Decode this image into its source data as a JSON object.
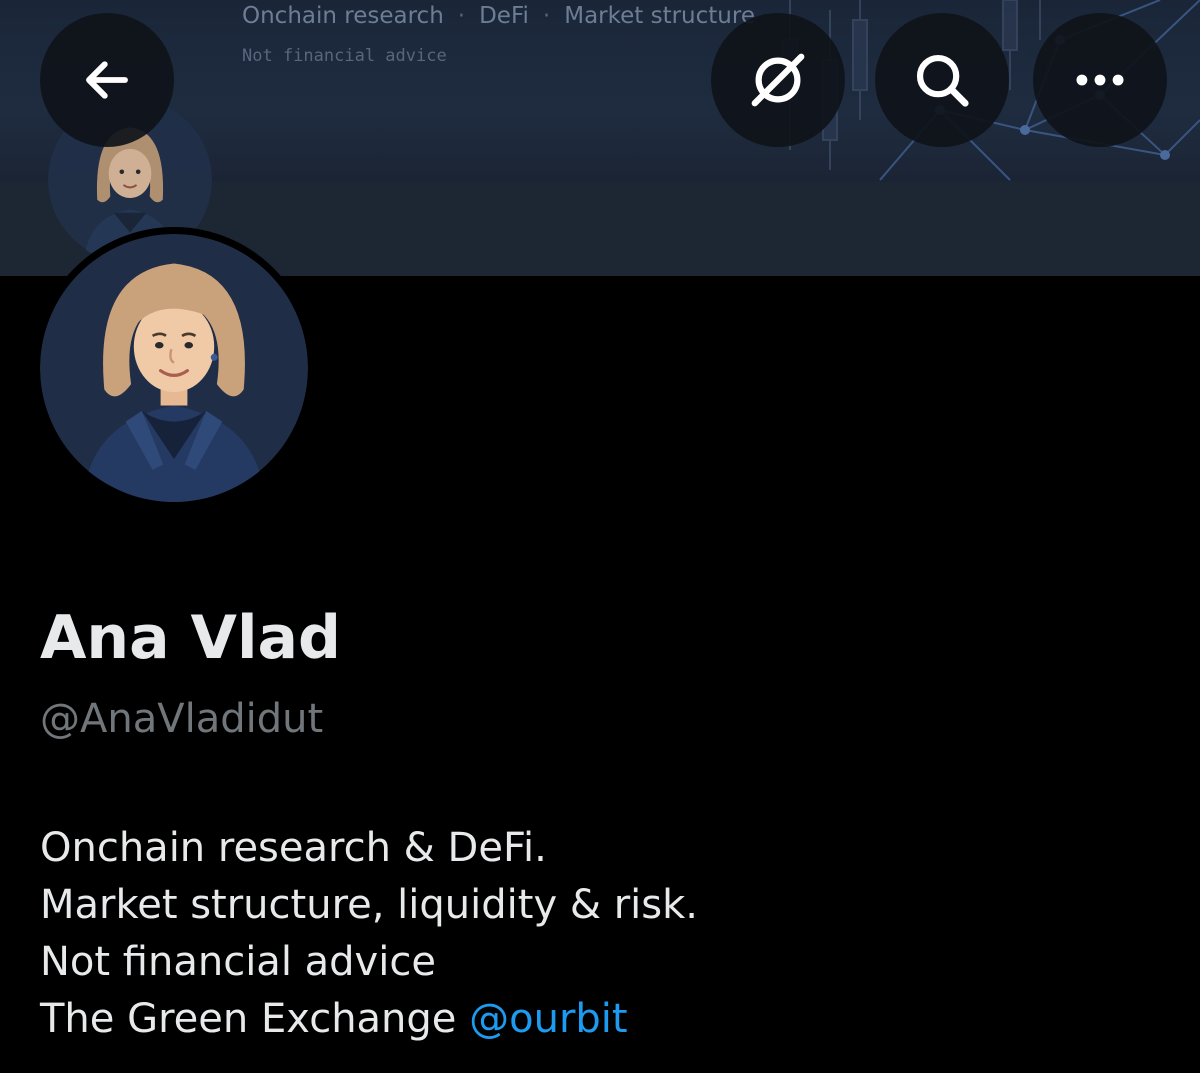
{
  "banner": {
    "tagline": [
      "Onchain research",
      "DeFi",
      "Market structure"
    ],
    "separator": "·",
    "note": "Not financial advice"
  },
  "header": {
    "back_icon": "arrow-left-icon",
    "grok_icon": "grok-icon",
    "search_icon": "search-icon",
    "more_icon": "more-horizontal-icon"
  },
  "profile": {
    "display_name": "Ana Vlad",
    "handle": "@AnaVladidut",
    "bio": {
      "line1": "Onchain research & DeFi.",
      "line2": "Market structure, liquidity & risk.",
      "line3": "Not financial advice",
      "line4_text": "The Green Exchange ",
      "line4_mention": "@ourbit"
    }
  },
  "colors": {
    "background": "#000000",
    "text_primary": "#e7e9ea",
    "text_secondary": "#71767b",
    "link": "#1d9bf0",
    "banner": "#1d2633"
  }
}
